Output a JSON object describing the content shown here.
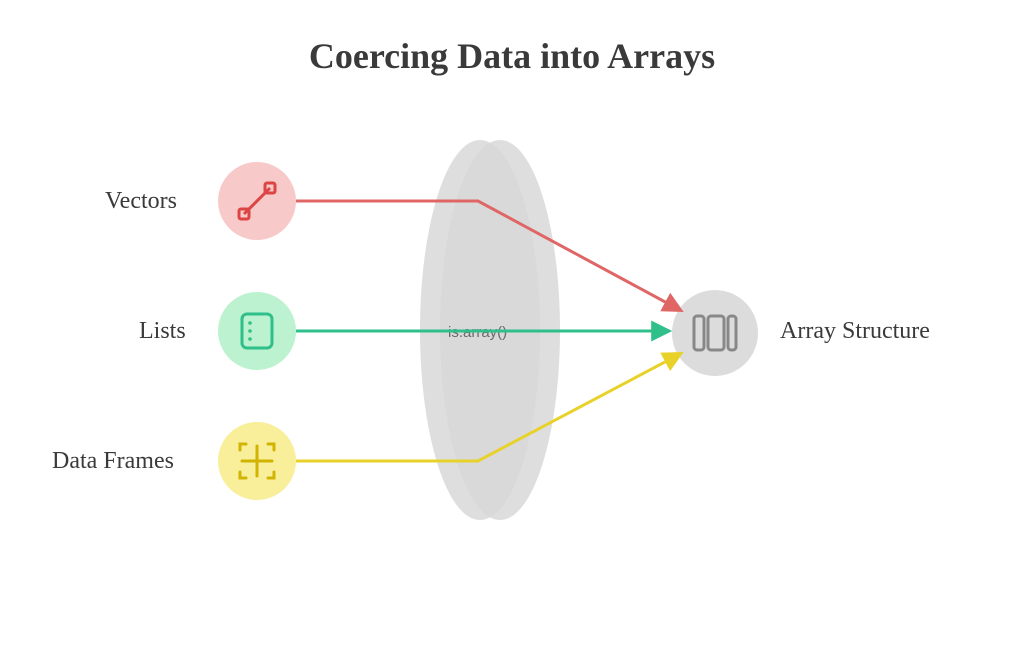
{
  "title": "Coercing Data into Arrays",
  "inputs": {
    "vectors": {
      "label": "Vectors",
      "color": "#e06666"
    },
    "lists": {
      "label": "Lists",
      "color": "#2fbf8a"
    },
    "frames": {
      "label": "Data Frames",
      "color": "#e8d22a"
    }
  },
  "function_label": "is.array()",
  "output": {
    "label": "Array Structure"
  }
}
